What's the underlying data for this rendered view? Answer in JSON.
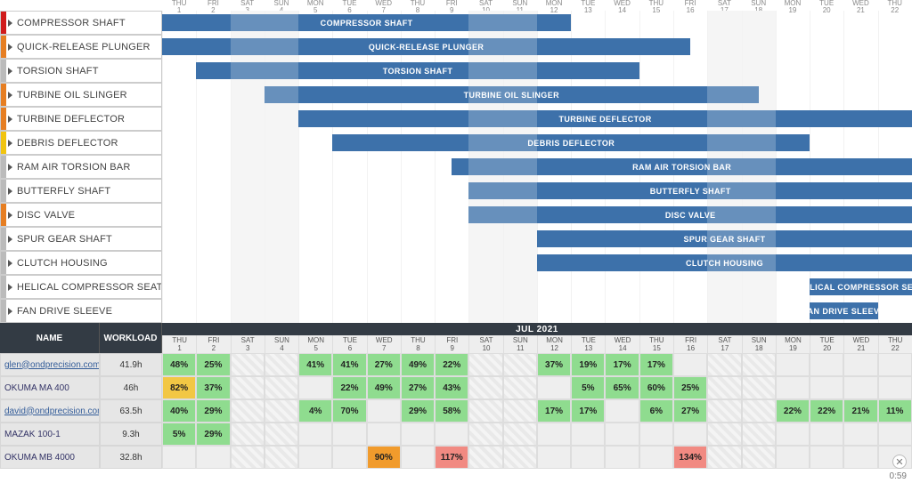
{
  "chart_data": {
    "type": "bar",
    "categories": [
      "Thu 1",
      "Fri 2",
      "Sat 3",
      "Sun 4",
      "Mon 5",
      "Tue 6",
      "Wed 7",
      "Thu 8",
      "Fri 9",
      "Sat 10",
      "Sun 11",
      "Mon 12",
      "Tue 13",
      "Wed 14",
      "Thu 15",
      "Fri 16",
      "Sat 17",
      "Sun 18",
      "Mon 19",
      "Tue 20",
      "Wed 21",
      "Thu 22"
    ],
    "title": "",
    "xlabel": "",
    "ylabel": "",
    "series": [
      {
        "name": "COMPRESSOR SHAFT",
        "start": 0,
        "end": 12,
        "shades": [
          [
            2,
            4
          ],
          [
            9,
            11
          ]
        ]
      },
      {
        "name": "QUICK-RELEASE PLUNGER",
        "start": 0,
        "end": 15.5,
        "shades": [
          [
            2,
            4
          ],
          [
            9,
            11
          ]
        ]
      },
      {
        "name": "TORSION SHAFT",
        "start": 1,
        "end": 14,
        "shades": [
          [
            2,
            4
          ],
          [
            9,
            11
          ]
        ]
      },
      {
        "name": "TURBINE OIL SLINGER",
        "start": 3,
        "end": 17.5,
        "shades": [
          [
            3,
            4
          ],
          [
            9,
            11
          ],
          [
            16,
            17.5
          ]
        ]
      },
      {
        "name": "TURBINE DEFLECTOR",
        "start": 4,
        "end": 22,
        "shades": [
          [
            9,
            11
          ],
          [
            16,
            18
          ]
        ]
      },
      {
        "name": "DEBRIS DEFLECTOR",
        "start": 5,
        "end": 19,
        "shades": [
          [
            9,
            11
          ],
          [
            16,
            18
          ]
        ]
      },
      {
        "name": "RAM AIR TORSION BAR",
        "start": 8.5,
        "end": 22,
        "shades": [
          [
            9,
            11
          ],
          [
            16,
            18
          ]
        ]
      },
      {
        "name": "BUTTERFLY SHAFT",
        "start": 9,
        "end": 25,
        "shades": [
          [
            9,
            11
          ],
          [
            16,
            18
          ]
        ]
      },
      {
        "name": "DISC VALVE",
        "start": 9,
        "end": 24,
        "shades": [
          [
            9,
            11
          ],
          [
            16,
            18
          ]
        ]
      },
      {
        "name": "SPUR GEAR SHAFT",
        "start": 11,
        "end": 30,
        "shades": [
          [
            16,
            18
          ]
        ]
      },
      {
        "name": "CLUTCH HOUSING",
        "start": 11,
        "end": 30,
        "shades": [
          [
            16,
            18
          ]
        ]
      },
      {
        "name": "HELICAL COMPRESSOR SEAT",
        "start": 19,
        "end": 30,
        "shades": []
      },
      {
        "name": "FAN DRIVE SLEEVE",
        "start": 19,
        "end": 21,
        "shades": []
      }
    ]
  },
  "gantt": {
    "days": [
      {
        "dow": "THU",
        "num": "1"
      },
      {
        "dow": "FRI",
        "num": "2"
      },
      {
        "dow": "SAT",
        "num": "3",
        "wend": true
      },
      {
        "dow": "SUN",
        "num": "4",
        "wend": true
      },
      {
        "dow": "MON",
        "num": "5"
      },
      {
        "dow": "TUE",
        "num": "6"
      },
      {
        "dow": "WED",
        "num": "7"
      },
      {
        "dow": "THU",
        "num": "8"
      },
      {
        "dow": "FRI",
        "num": "9"
      },
      {
        "dow": "SAT",
        "num": "10",
        "wend": true
      },
      {
        "dow": "SUN",
        "num": "11",
        "wend": true
      },
      {
        "dow": "MON",
        "num": "12"
      },
      {
        "dow": "TUE",
        "num": "13"
      },
      {
        "dow": "WED",
        "num": "14"
      },
      {
        "dow": "THU",
        "num": "15"
      },
      {
        "dow": "FRI",
        "num": "16"
      },
      {
        "dow": "SAT",
        "num": "17",
        "wend": true
      },
      {
        "dow": "SUN",
        "num": "18",
        "wend": true
      },
      {
        "dow": "MON",
        "num": "19"
      },
      {
        "dow": "TUE",
        "num": "20"
      },
      {
        "dow": "WED",
        "num": "21"
      },
      {
        "dow": "THU",
        "num": "22"
      }
    ],
    "tasks": [
      {
        "label": "COMPRESSOR SHAFT",
        "color": "cred"
      },
      {
        "label": "QUICK-RELEASE PLUNGER",
        "color": "corange"
      },
      {
        "label": "TORSION SHAFT",
        "color": "cgray"
      },
      {
        "label": "TURBINE OIL SLINGER",
        "color": "corange"
      },
      {
        "label": "TURBINE DEFLECTOR",
        "color": "corange"
      },
      {
        "label": "DEBRIS DEFLECTOR",
        "color": "cyellow"
      },
      {
        "label": "RAM AIR TORSION BAR",
        "color": "cgray"
      },
      {
        "label": "BUTTERFLY SHAFT",
        "color": "cgray"
      },
      {
        "label": "DISC VALVE",
        "color": "corange"
      },
      {
        "label": "SPUR GEAR SHAFT",
        "color": "cgray"
      },
      {
        "label": "CLUTCH HOUSING",
        "color": "cgray"
      },
      {
        "label": "HELICAL COMPRESSOR SEAT",
        "color": "cgray"
      },
      {
        "label": "FAN DRIVE SLEEVE",
        "color": "cgray"
      }
    ]
  },
  "workload": {
    "month": "JUL 2021",
    "name_header": "NAME",
    "workload_header": "WORKLOAD",
    "days": [
      {
        "dow": "THU",
        "num": "1"
      },
      {
        "dow": "FRI",
        "num": "2"
      },
      {
        "dow": "SAT",
        "num": "3",
        "wend": true
      },
      {
        "dow": "SUN",
        "num": "4",
        "wend": true
      },
      {
        "dow": "MON",
        "num": "5"
      },
      {
        "dow": "TUE",
        "num": "6"
      },
      {
        "dow": "WED",
        "num": "7"
      },
      {
        "dow": "THU",
        "num": "8"
      },
      {
        "dow": "FRI",
        "num": "9"
      },
      {
        "dow": "SAT",
        "num": "10",
        "wend": true
      },
      {
        "dow": "SUN",
        "num": "11",
        "wend": true
      },
      {
        "dow": "MON",
        "num": "12"
      },
      {
        "dow": "TUE",
        "num": "13"
      },
      {
        "dow": "WED",
        "num": "14"
      },
      {
        "dow": "THU",
        "num": "15"
      },
      {
        "dow": "FRI",
        "num": "16"
      },
      {
        "dow": "SAT",
        "num": "17",
        "wend": true
      },
      {
        "dow": "SUN",
        "num": "18",
        "wend": true
      },
      {
        "dow": "MON",
        "num": "19"
      },
      {
        "dow": "TUE",
        "num": "20"
      },
      {
        "dow": "WED",
        "num": "21"
      },
      {
        "dow": "THU",
        "num": "22"
      }
    ],
    "rows": [
      {
        "name": "glen@ondprecision.com",
        "link": true,
        "wl": "41.9h",
        "cells": [
          {
            "v": "48%",
            "c": "green"
          },
          {
            "v": "25%",
            "c": "green"
          },
          {
            "wend": true
          },
          {
            "wend": true
          },
          {
            "v": "41%",
            "c": "green"
          },
          {
            "v": "41%",
            "c": "green"
          },
          {
            "v": "27%",
            "c": "green"
          },
          {
            "v": "49%",
            "c": "green"
          },
          {
            "v": "22%",
            "c": "green"
          },
          {
            "wend": true
          },
          {
            "wend": true
          },
          {
            "v": "37%",
            "c": "green"
          },
          {
            "v": "19%",
            "c": "green"
          },
          {
            "v": "17%",
            "c": "green"
          },
          {
            "v": "17%",
            "c": "green"
          },
          {},
          {
            "wend": true
          },
          {
            "wend": true
          },
          {},
          {},
          {},
          {}
        ]
      },
      {
        "name": "OKUMA MA 400",
        "wl": "46h",
        "cells": [
          {
            "v": "82%",
            "c": "yellow"
          },
          {
            "v": "37%",
            "c": "green"
          },
          {
            "wend": true
          },
          {
            "wend": true
          },
          {},
          {
            "v": "22%",
            "c": "green"
          },
          {
            "v": "49%",
            "c": "green"
          },
          {
            "v": "27%",
            "c": "green"
          },
          {
            "v": "43%",
            "c": "green"
          },
          {
            "wend": true
          },
          {
            "wend": true
          },
          {},
          {
            "v": "5%",
            "c": "green"
          },
          {
            "v": "65%",
            "c": "green"
          },
          {
            "v": "60%",
            "c": "green"
          },
          {
            "v": "25%",
            "c": "green"
          },
          {
            "wend": true
          },
          {
            "wend": true
          },
          {},
          {},
          {},
          {}
        ]
      },
      {
        "name": "david@ondprecision.com",
        "link": true,
        "wl": "63.5h",
        "cells": [
          {
            "v": "40%",
            "c": "green"
          },
          {
            "v": "29%",
            "c": "green"
          },
          {
            "wend": true
          },
          {
            "wend": true
          },
          {
            "v": "4%",
            "c": "green"
          },
          {
            "v": "70%",
            "c": "green"
          },
          {},
          {
            "v": "29%",
            "c": "green"
          },
          {
            "v": "58%",
            "c": "green"
          },
          {
            "wend": true
          },
          {
            "wend": true
          },
          {
            "v": "17%",
            "c": "green"
          },
          {
            "v": "17%",
            "c": "green"
          },
          {},
          {
            "v": "6%",
            "c": "green"
          },
          {
            "v": "27%",
            "c": "green"
          },
          {
            "wend": true
          },
          {
            "wend": true
          },
          {
            "v": "22%",
            "c": "green"
          },
          {
            "v": "22%",
            "c": "green"
          },
          {
            "v": "21%",
            "c": "green"
          },
          {
            "v": "11%",
            "c": "green"
          }
        ]
      },
      {
        "name": "MAZAK 100-1",
        "wl": "9.3h",
        "cells": [
          {
            "v": "5%",
            "c": "green"
          },
          {
            "v": "29%",
            "c": "green"
          },
          {
            "wend": true
          },
          {
            "wend": true
          },
          {},
          {},
          {},
          {},
          {},
          {
            "wend": true
          },
          {
            "wend": true
          },
          {},
          {},
          {},
          {},
          {},
          {
            "wend": true
          },
          {
            "wend": true
          },
          {},
          {},
          {},
          {}
        ]
      },
      {
        "name": "OKUMA MB 4000",
        "wl": "32.8h",
        "cells": [
          {},
          {},
          {
            "wend": true
          },
          {
            "wend": true
          },
          {},
          {},
          {
            "v": "90%",
            "c": "orange"
          },
          {},
          {
            "v": "117%",
            "c": "red"
          },
          {
            "wend": true
          },
          {
            "wend": true
          },
          {},
          {},
          {},
          {},
          {
            "v": "134%",
            "c": "red"
          },
          {
            "wend": true
          },
          {
            "wend": true
          },
          {},
          {},
          {},
          {}
        ]
      }
    ]
  },
  "footer": {
    "time": "0:59"
  },
  "colors": {
    "bar": "#3d71aa",
    "green": "#8fdc8f",
    "yellow": "#f2c744",
    "orange": "#f19b2c",
    "red": "#f18a82"
  }
}
